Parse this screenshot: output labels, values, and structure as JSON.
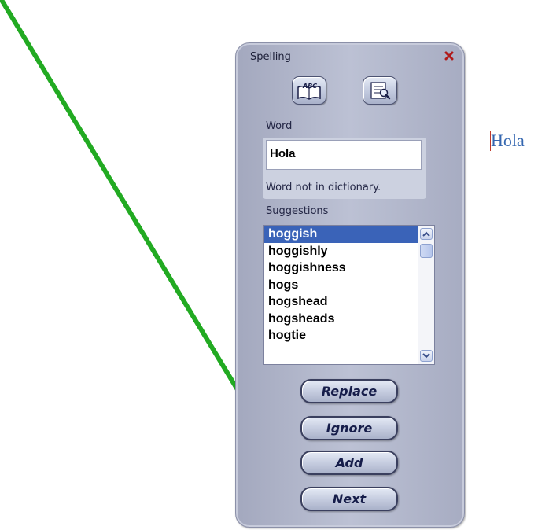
{
  "panel": {
    "title": "Spelling",
    "close_icon": "close-x-icon",
    "tools": [
      {
        "name": "spellcheck-book-icon"
      },
      {
        "name": "find-document-icon"
      }
    ],
    "word_label": "Word",
    "word_value": "Hola",
    "status": "Word not in dictionary.",
    "suggestions_label": "Suggestions",
    "suggestions": [
      "hoggish",
      "hoggishly",
      "hoggishness",
      "hogs",
      "hogshead",
      "hogsheads",
      "hogtie"
    ],
    "selected_suggestion": "hoggish",
    "buttons": {
      "replace": "Replace",
      "ignore": "Ignore",
      "add": "Add",
      "next": "Next"
    }
  },
  "document": {
    "text": "Hola"
  },
  "colors": {
    "annotation_arrow": "#22aa22",
    "selection": "#3a63b8"
  }
}
